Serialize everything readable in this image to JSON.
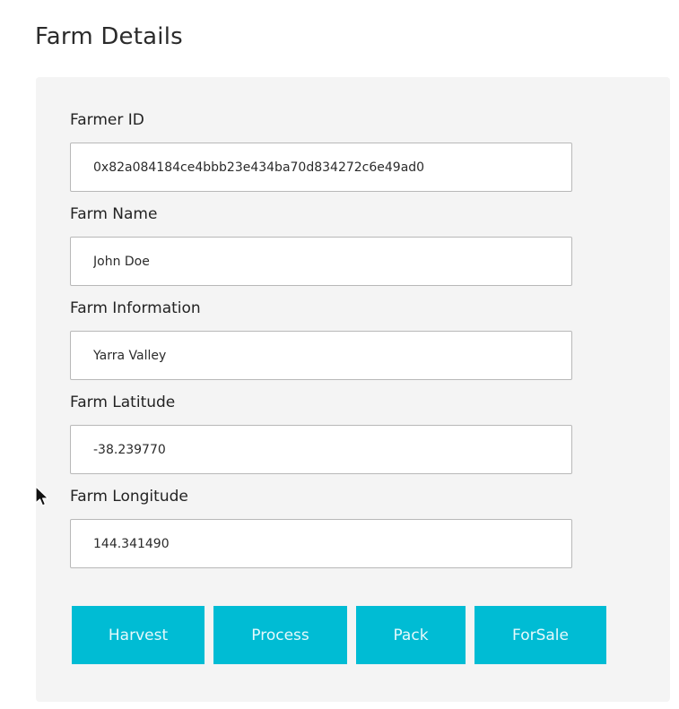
{
  "page": {
    "title": "Farm Details"
  },
  "form": {
    "fields": [
      {
        "label": "Farmer ID",
        "value": "0x82a084184ce4bbb23e434ba70d834272c6e49ad0"
      },
      {
        "label": "Farm Name",
        "value": "John Doe"
      },
      {
        "label": "Farm Information",
        "value": "Yarra Valley"
      },
      {
        "label": "Farm Latitude",
        "value": "-38.239770"
      },
      {
        "label": "Farm Longitude",
        "value": "144.341490"
      }
    ]
  },
  "actions": {
    "harvest": "Harvest",
    "process": "Process",
    "pack": "Pack",
    "for_sale": "ForSale"
  },
  "colors": {
    "button_bg": "#00bcd4",
    "panel_bg": "#f4f4f4"
  },
  "icons": {
    "cursor": "mouse-pointer-icon"
  }
}
